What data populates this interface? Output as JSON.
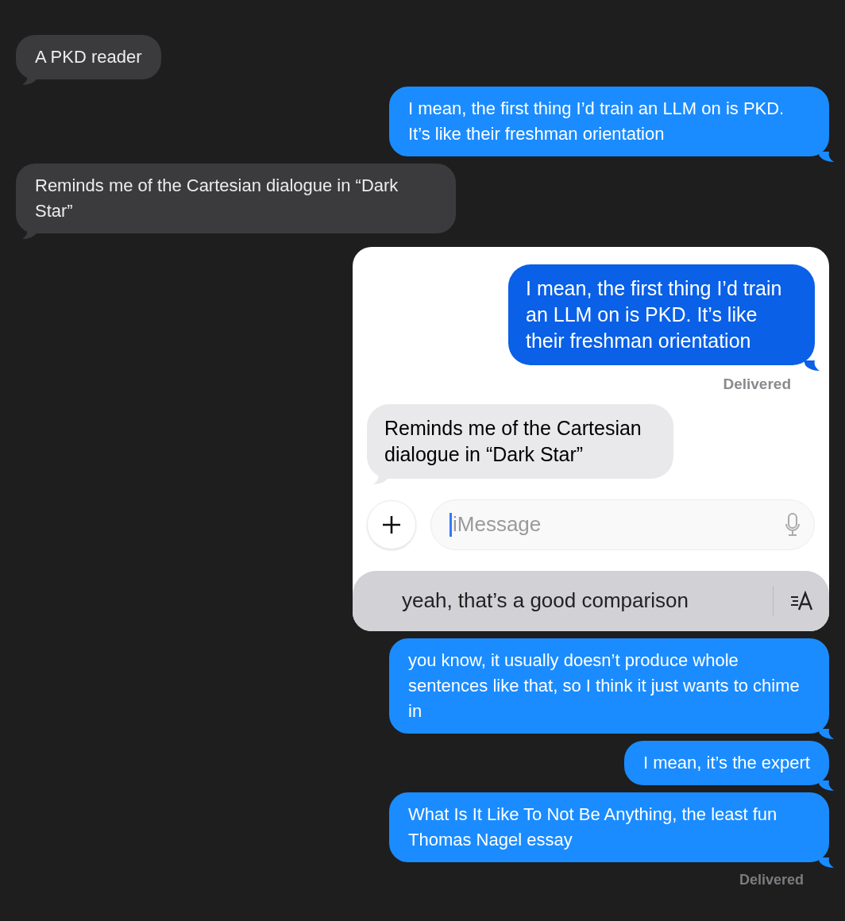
{
  "messages": [
    {
      "kind": "received",
      "text": "A PKD reader"
    },
    {
      "kind": "sent",
      "text": "I mean, the first thing I’d train an LLM on is PKD. It’s like their freshman orientation"
    },
    {
      "kind": "received",
      "text": "Reminds me of the Cartesian dialogue in “Dark Star”"
    },
    {
      "kind": "screenshot",
      "messages": [
        {
          "kind": "sent",
          "text": "I mean, the first thing I’d train an LLM on is PKD. It’s like their freshman orientation"
        },
        {
          "kind": "status",
          "text": "Delivered"
        },
        {
          "kind": "received",
          "text": "Reminds me of the Cartesian dialogue in “Dark Star”"
        }
      ],
      "input": {
        "placeholder": "iMessage"
      },
      "suggestion": "yeah, that’s a good comparison"
    },
    {
      "kind": "sent",
      "text": "you know, it usually doesn’t produce whole sentences like that, so I think it just wants to chime in"
    },
    {
      "kind": "sent",
      "text": "I mean, it’s the expert"
    },
    {
      "kind": "sent",
      "text": "What Is It Like To Not Be Anything, the least fun Thomas Nagel essay"
    },
    {
      "kind": "status",
      "text": "Delivered"
    }
  ]
}
